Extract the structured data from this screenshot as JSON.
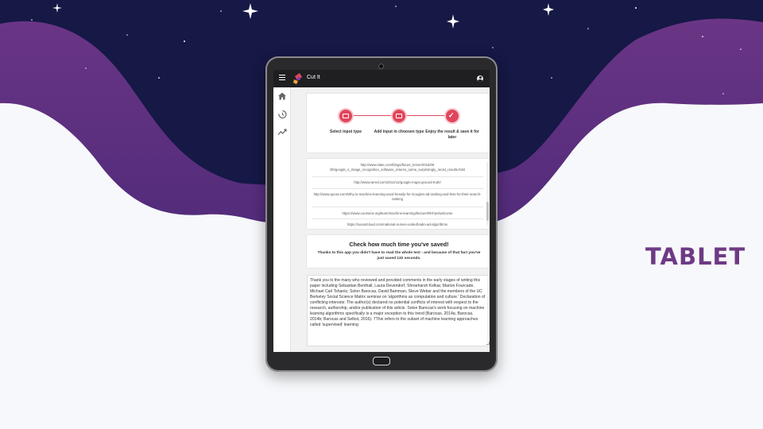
{
  "slide": {
    "label": "TABLET"
  },
  "colors": {
    "accent": "#e0455c",
    "appbar": "#1f1f22",
    "brand_purple": "#6e3a84",
    "night_sky": "#161845"
  },
  "app": {
    "title": "Cut It",
    "menu_icon": "hamburger-menu-icon",
    "account_icon": "account-circle-icon"
  },
  "nav": [
    {
      "icon": "home-icon"
    },
    {
      "icon": "history-icon"
    },
    {
      "icon": "trending-icon"
    }
  ],
  "stepper": {
    "steps": [
      {
        "label": "Select input type",
        "icon": "input-icon"
      },
      {
        "label": "Add input in choosen type",
        "icon": "input-icon"
      },
      {
        "label": "Enjoy the result & save it for later",
        "icon": "check-icon"
      }
    ]
  },
  "links": [
    "http://www.slate.com/blogs/future_tense/2015/06 /30/google_s_image_recognition_software_returns_some_surprisingly_racist_results.html",
    "http://www.wired.com/2014/12/google-maps-ground-truth/",
    "http://www.quora.com/Why-is-machine-learning-used-heavily-for-Googles-ad-ranking-and-less-for-their-search-ranking",
    "https://www.coursera.org/learn/machine-learning/lecture/RKFpn/welcome",
    "https://soundcloud.com/national-nurses-united/radio-ad-algorithms"
  ],
  "saved": {
    "title": "Check how much time you've saved!",
    "text": "Thanks to this app you didn't have to read the whole text - and because of that fact you've just saved 132 seconds."
  },
  "text_area": {
    "content": "Thank you to the many who reviewed and provided comments in the early stages of writing this paper including Sebastian Benthall, Laura Devendorf, Shreeharsh Kelkar, Marion Fourcade, Michael Carl Tshantz, Solon Barocas, David Bamman, Steve Weber and the members of the UC Berkeley Social Science Matrix seminar on 'algorithms as computation and culture.' Declaration of conflicting interests: The author(s) declared no potential conflicts of interest with respect to the research, authorship, and/or publication of this article. Solon Barocas's work focusing on machine learning algorithms specifically is a major exception to this trend (Barocas, 2014a; Barocas, 2014b; Barocas and Selbst, 2016). 7This refers to the subset of machine learning approaches called 'supervised' learning"
  }
}
